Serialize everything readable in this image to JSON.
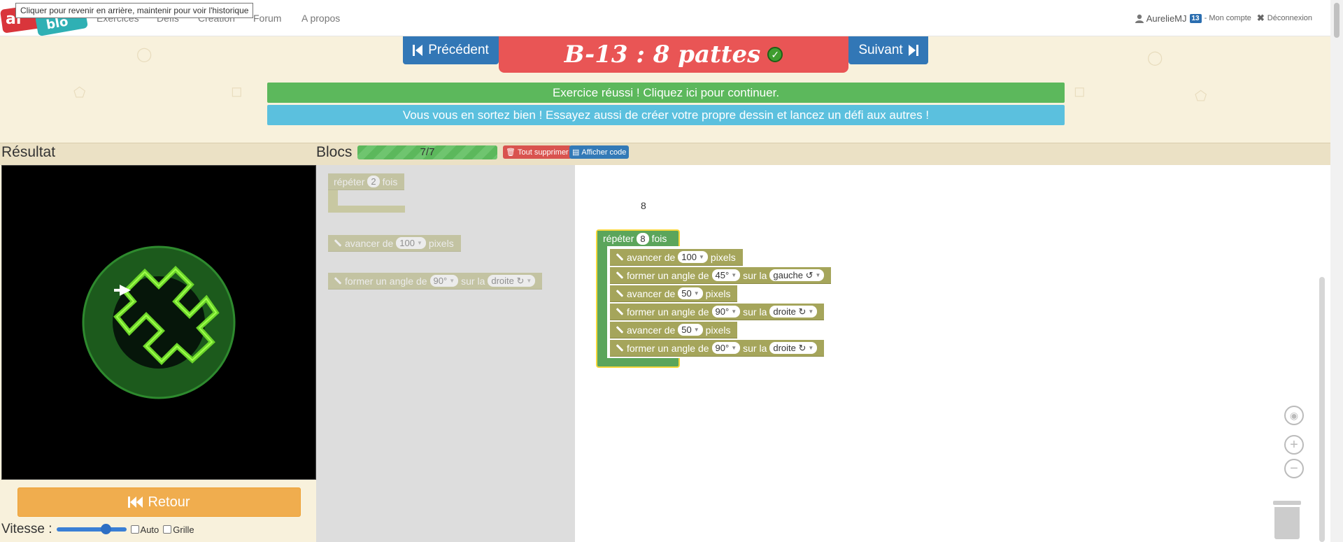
{
  "nav": {
    "logo_part1": "al",
    "logo_part2": "blo",
    "tooltip": "Cliquer pour revenir en arrière, maintenir pour voir l'historique",
    "links": [
      "Exercices",
      "Défis",
      "Création",
      "Forum",
      "A propos"
    ],
    "user": "AurelieMJ",
    "level_badge": "13",
    "account": "- Mon compte",
    "logout": "Déconnexion"
  },
  "header": {
    "prev_label": "Précédent",
    "next_label": "Suivant",
    "title": "B-13 : 8 pattes",
    "success_msg": "Exercice réussi ! Cliquez ici pour continuer.",
    "info_msg": "Vous vous en sortez bien ! Essayez aussi de créer votre propre dessin et lancez un défi aux autres !"
  },
  "result": {
    "title": "Résultat",
    "retour_label": "Retour",
    "speed_label": "Vitesse :",
    "speed_level": 0.75,
    "auto_label": "Auto",
    "grid_label": "Grille"
  },
  "blocks_panel": {
    "title": "Blocs",
    "progress": "7/7",
    "delete_all": "Tout supprimer",
    "show_code": "Afficher code"
  },
  "toolbox": {
    "repeat": {
      "pre": "répéter",
      "value": "2",
      "post": "fois"
    },
    "forward": {
      "pre": "avancer de",
      "value": "100",
      "post": "pixels"
    },
    "turn": {
      "pre": "former un angle de",
      "value": "90°",
      "mid": "sur la",
      "dir": "droite ↻"
    }
  },
  "workspace": {
    "comment": "8",
    "repeat": {
      "pre": "répéter",
      "value": "8",
      "post": "fois"
    },
    "statements": [
      {
        "kind": "forward",
        "pre": "avancer de",
        "value": "100",
        "post": "pixels"
      },
      {
        "kind": "turn",
        "pre": "former un angle de",
        "value": "45°",
        "mid": "sur la",
        "dir": "gauche ↺"
      },
      {
        "kind": "forward",
        "pre": "avancer de",
        "value": "50",
        "post": "pixels"
      },
      {
        "kind": "turn",
        "pre": "former un angle de",
        "value": "90°",
        "mid": "sur la",
        "dir": "droite ↻"
      },
      {
        "kind": "forward",
        "pre": "avancer de",
        "value": "50",
        "post": "pixels"
      },
      {
        "kind": "turn",
        "pre": "former un angle de",
        "value": "90°",
        "mid": "sur la",
        "dir": "droite ↻"
      }
    ]
  },
  "colors": {
    "accent_red": "#e95555",
    "nav_blue": "#3277b6",
    "success_green": "#5cb85c",
    "info_blue": "#5bc0de",
    "block_gold": "#a5a55b",
    "block_green": "#5ba55b",
    "retour_orange": "#f0ad4e"
  },
  "icons": [
    "user-icon",
    "logout-icon",
    "step-backward-icon",
    "step-forward-icon",
    "check-icon",
    "trash-icon",
    "code-icon",
    "fast-backward-icon",
    "recenter-icon",
    "zoom-in-icon",
    "zoom-out-icon"
  ]
}
